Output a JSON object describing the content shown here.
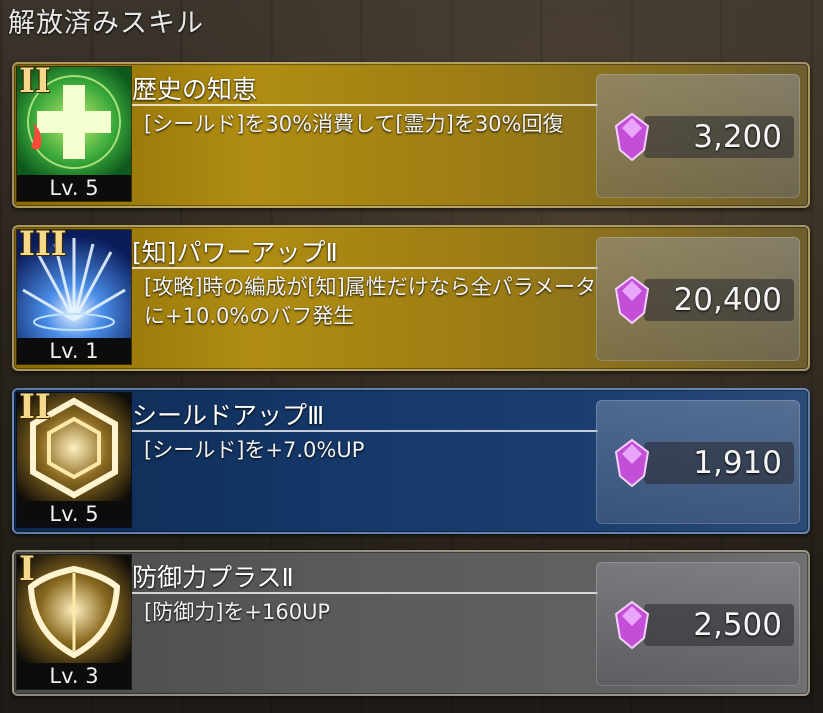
{
  "header": {
    "title": "解放済みスキル"
  },
  "skills": [
    {
      "tier": "II",
      "level": "Lv. 5",
      "name": "歴史の知恵",
      "description": "[シールド]を30%消費して[霊力]を30%回復",
      "cost": "3,200",
      "theme": "gold",
      "icon": "green-cross-heal-icon"
    },
    {
      "tier": "III",
      "level": "Lv. 1",
      "name": "[知]パワーアップⅡ",
      "description": "[攻略]時の編成が[知]属性だけなら全パラメータに+10.0%のバフ発生",
      "cost": "20,400",
      "theme": "gold",
      "icon": "blue-burst-power-icon"
    },
    {
      "tier": "II",
      "level": "Lv. 5",
      "name": "シールドアップⅢ",
      "description": "[シールド]を+7.0%UP",
      "cost": "1,910",
      "theme": "blue",
      "icon": "hexagon-shield-icon"
    },
    {
      "tier": "I",
      "level": "Lv. 3",
      "name": "防御力プラスⅡ",
      "description": "[防御力]を+160UP",
      "cost": "2,500",
      "theme": "gray",
      "icon": "crest-shield-icon"
    }
  ],
  "colors": {
    "gold_card": "#b08d12",
    "blue_card": "#143869",
    "gray_card": "#5a5a5a",
    "gem": "#c24fd6"
  }
}
